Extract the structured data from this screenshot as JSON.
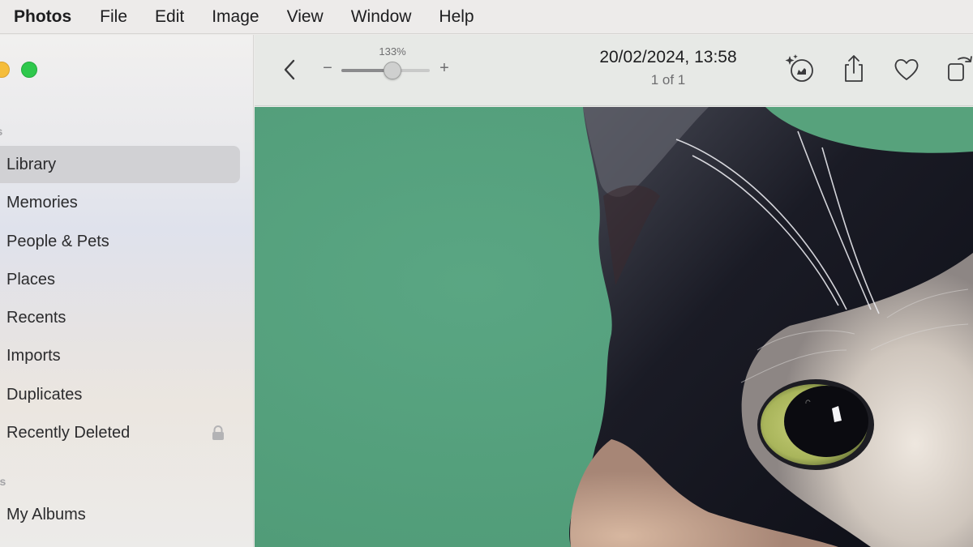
{
  "menubar": {
    "app": "Photos",
    "items": [
      "File",
      "Edit",
      "Image",
      "View",
      "Window",
      "Help"
    ]
  },
  "sidebar": {
    "section_photos": "os",
    "items": [
      {
        "label": "Library",
        "selected": true
      },
      {
        "label": "Memories"
      },
      {
        "label": "People & Pets"
      },
      {
        "label": "Places"
      },
      {
        "label": "Recents"
      },
      {
        "label": "Imports"
      },
      {
        "label": "Duplicates"
      },
      {
        "label": "Recently Deleted",
        "icon": "lock-icon"
      }
    ],
    "section_albums": "ms",
    "album_items": [
      {
        "label": "My Albums"
      }
    ]
  },
  "toolbar": {
    "zoom_label": "133%",
    "zoom_minus": "−",
    "zoom_plus": "+",
    "zoom_fraction": 0.58,
    "date": "20/02/2024, 13:58",
    "count": "1 of 1",
    "icons": [
      "back-chevron-icon",
      "auto-enhance-icon",
      "share-icon",
      "favorite-heart-icon",
      "rotate-icon"
    ]
  },
  "colors": {
    "photo_background": "#56a07d",
    "selected_row": "#d1d1d4",
    "traffic_yellow": "#f5bd3b",
    "traffic_green": "#2ec84c"
  }
}
